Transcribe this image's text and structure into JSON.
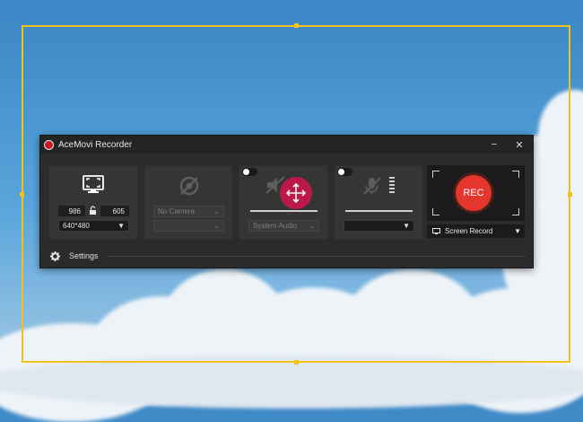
{
  "app": {
    "title": "AceMovi Recorder",
    "minimize": "−",
    "close": "✕"
  },
  "screen_panel": {
    "width": "986",
    "height": "605",
    "resolution": "640*480",
    "icon": "screen-capture-icon"
  },
  "camera_panel": {
    "camera": "No Camera",
    "secondary": "",
    "icon": "camera-off-icon"
  },
  "audio_panel": {
    "source": "System Audio",
    "icon": "speaker-muted-icon",
    "enabled": false
  },
  "mic_panel": {
    "device": "",
    "icon": "microphone-muted-icon",
    "enabled": false
  },
  "record": {
    "label": "REC",
    "mode": "Screen Record"
  },
  "settings": {
    "label": "Settings"
  },
  "colors": {
    "frame": "#f2c21c",
    "rec": "#e5362d",
    "window": "#2b2b2b"
  }
}
